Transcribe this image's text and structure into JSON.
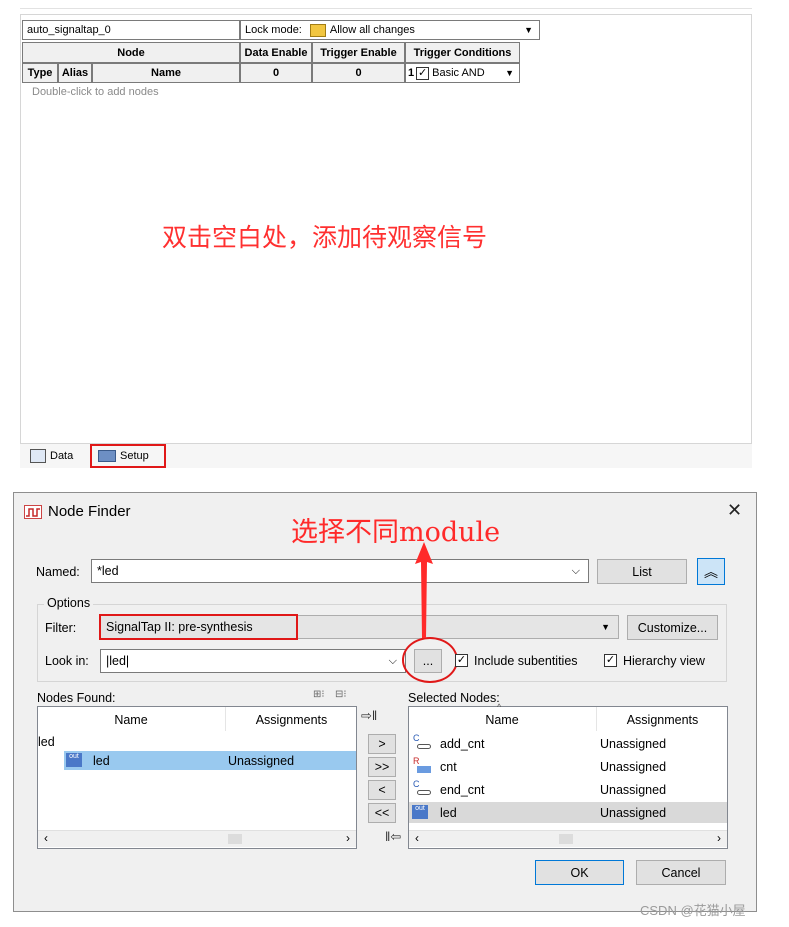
{
  "signaltap": {
    "instance_name": "auto_signaltap_0",
    "lock_mode_label": "Lock mode:",
    "lock_mode_value": "Allow all changes",
    "headers": {
      "node": "Node",
      "data_enable": "Data Enable",
      "trigger_enable": "Trigger Enable",
      "trigger_conditions": "Trigger Conditions"
    },
    "subheaders": {
      "type": "Type",
      "alias": "Alias",
      "name": "Name",
      "data_enable_count": "0",
      "trigger_enable_count": "0",
      "trigger_cond_index": "1",
      "trigger_cond_value": "Basic AND"
    },
    "empty_hint": "Double-click to add nodes",
    "annotation": "双击空白处，添加待观察信号",
    "tabs": {
      "data": "Data",
      "setup": "Setup"
    }
  },
  "node_finder": {
    "title": "Node Finder",
    "annotation": "选择不同module",
    "named_label": "Named:",
    "named_value": "*led",
    "list_button": "List",
    "options_label": "Options",
    "filter_label": "Filter:",
    "filter_value": "SignalTap II: pre-synthesis",
    "customize_button": "Customize...",
    "lookin_label": "Look in:",
    "lookin_value": "|led|",
    "browse_button": "...",
    "include_subentities": "Include subentities",
    "hierarchy_view": "Hierarchy view",
    "nodes_found_label": "Nodes Found:",
    "selected_nodes_label": "Selected Nodes:",
    "col_name": "Name",
    "col_assignments": "Assignments",
    "found_group": "led",
    "found_nodes": [
      {
        "name": "led",
        "assignment": "Unassigned"
      }
    ],
    "selected_nodes": [
      {
        "name": "add_cnt",
        "assignment": "Unassigned",
        "icon": "C"
      },
      {
        "name": "cnt",
        "assignment": "Unassigned",
        "icon": "R"
      },
      {
        "name": "end_cnt",
        "assignment": "Unassigned",
        "icon": "C"
      },
      {
        "name": "led",
        "assignment": "Unassigned",
        "icon": "out"
      }
    ],
    "move_buttons": [
      ">",
      ">>",
      "<",
      "<<"
    ],
    "ok_button": "OK",
    "cancel_button": "Cancel"
  },
  "watermark": "CSDN @花猫小屋",
  "colors": {
    "annotation_red": "#ff3030",
    "selection_blue": "#99c9ef",
    "selected_gray": "#d9d9d9"
  }
}
